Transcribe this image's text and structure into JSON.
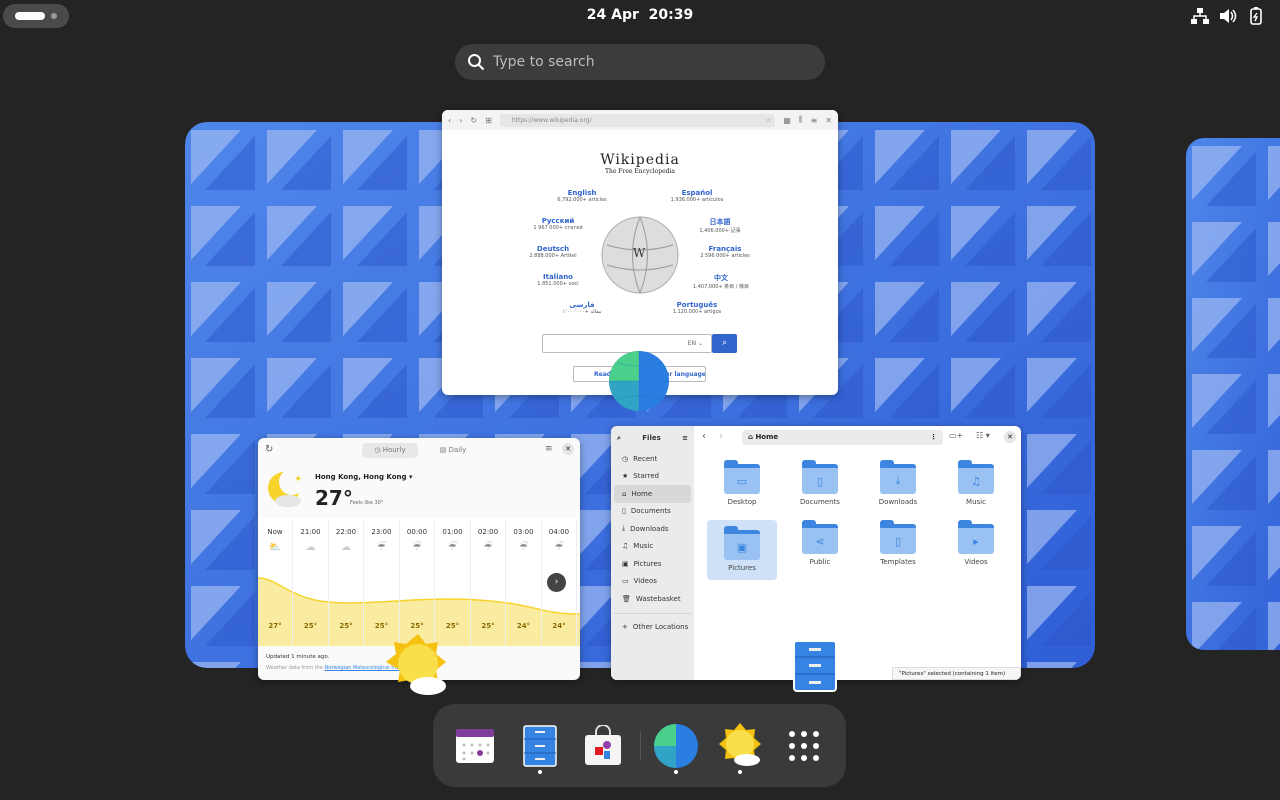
{
  "topbar": {
    "clock": "24 Apr  20:39",
    "tray": [
      "network-icon",
      "volume-icon",
      "battery-icon"
    ]
  },
  "search": {
    "placeholder": "Type to search"
  },
  "wikipedia": {
    "url": "https://www.wikipedia.org/",
    "title": "Wikipedia",
    "tagline": "The Free Encyclopedia",
    "languages": [
      {
        "name": "English",
        "count": "6,792,000+ articles"
      },
      {
        "name": "Español",
        "count": "1.936.000+ artículos"
      },
      {
        "name": "Русский",
        "count": "1 967 000+ статей"
      },
      {
        "name": "日本語",
        "count": "1,406,000+ 記事"
      },
      {
        "name": "Deutsch",
        "count": "2.888.000+ Artikel"
      },
      {
        "name": "Français",
        "count": "2 596 000+ articles"
      },
      {
        "name": "Italiano",
        "count": "1.851.000+ voci"
      },
      {
        "name": "中文",
        "count": "1,407,000+ 条目 / 條目"
      },
      {
        "name": "فارسی",
        "count": "۱٬۰۰۰٬۰۰۰+ مقاله"
      },
      {
        "name": "Português",
        "count": "1.120.000+ artigos"
      }
    ],
    "search_lang": "EN",
    "read_button": "Read Wikipedia in your language"
  },
  "weather": {
    "tabs": [
      "Hourly",
      "Daily"
    ],
    "location": "Hong Kong, Hong Kong",
    "temp": "27°",
    "feels": "Feels like 30°",
    "hours": [
      {
        "time": "Now",
        "temp": "27°"
      },
      {
        "time": "21:00",
        "temp": "25°"
      },
      {
        "time": "22:00",
        "temp": "25°"
      },
      {
        "time": "23:00",
        "temp": "25°"
      },
      {
        "time": "00:00",
        "temp": "25°"
      },
      {
        "time": "01:00",
        "temp": "25°"
      },
      {
        "time": "02:00",
        "temp": "25°"
      },
      {
        "time": "03:00",
        "temp": "24°"
      },
      {
        "time": "04:00",
        "temp": "24°"
      }
    ],
    "updated": "Updated 1 minute ago.",
    "source_prefix": "Weather data from the ",
    "source_link": "Norwegian Meteorological Institute"
  },
  "files": {
    "title": "Files",
    "path": "Home",
    "sidebar": [
      {
        "label": "Recent",
        "icon": "◷"
      },
      {
        "label": "Starred",
        "icon": "★"
      },
      {
        "label": "Home",
        "icon": "⌂"
      },
      {
        "label": "Documents",
        "icon": "▯"
      },
      {
        "label": "Downloads",
        "icon": "⤓"
      },
      {
        "label": "Music",
        "icon": "♫"
      },
      {
        "label": "Pictures",
        "icon": "▣"
      },
      {
        "label": "Videos",
        "icon": "▭"
      },
      {
        "label": "Wastebasket",
        "icon": "🗑"
      }
    ],
    "other": "Other Locations",
    "folders": [
      {
        "label": "Desktop",
        "icon": "▭"
      },
      {
        "label": "Documents",
        "icon": "▯"
      },
      {
        "label": "Downloads",
        "icon": "⤓"
      },
      {
        "label": "Music",
        "icon": "♫"
      },
      {
        "label": "Pictures",
        "icon": "▣"
      },
      {
        "label": "Public",
        "icon": "⋖"
      },
      {
        "label": "Templates",
        "icon": "▯"
      },
      {
        "label": "Videos",
        "icon": "▸"
      }
    ],
    "status": "\"Pictures\" selected  (containing 1 item)"
  },
  "dash": [
    "calendar-icon",
    "files-icon",
    "software-icon",
    "web-browser-icon",
    "weather-icon",
    "app-grid-icon"
  ],
  "colors": {
    "background": "#242424",
    "accent": "#3584e4",
    "wallpaper": "#3f6fe0"
  }
}
